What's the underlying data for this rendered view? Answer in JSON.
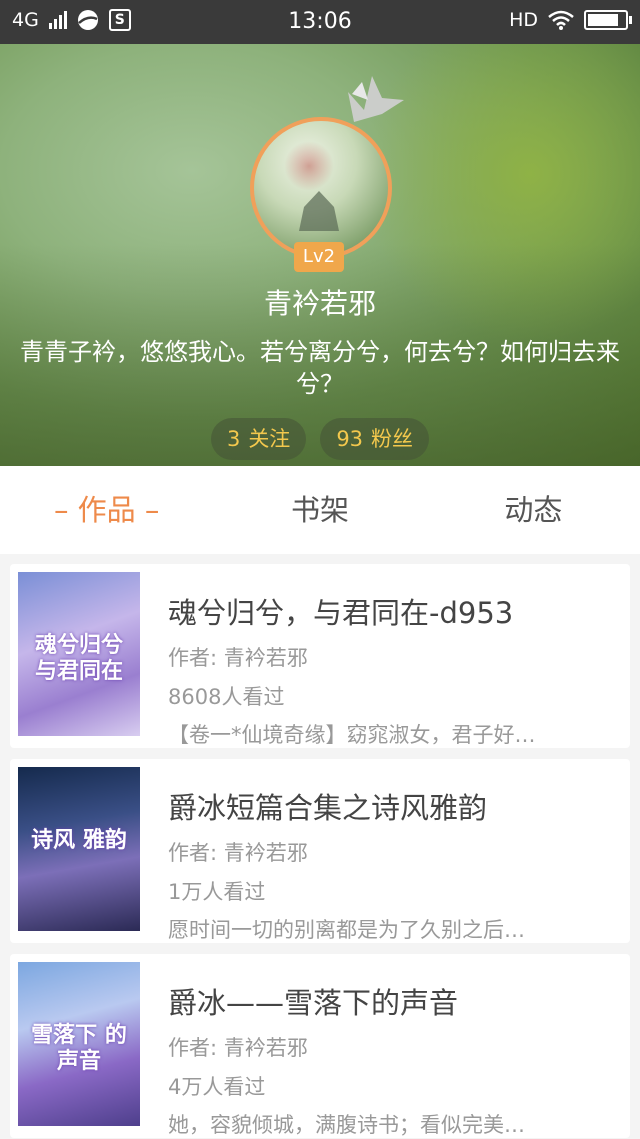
{
  "status_bar": {
    "network": "4G",
    "time": "13:06",
    "hd": "HD",
    "app_icon_letter": "S",
    "battery_level": 0.95
  },
  "profile": {
    "level": "Lv2",
    "username": "青衿若邪",
    "bio": "青青子衿，悠悠我心。若兮离分兮，何去兮？如何归去来兮？",
    "following_count": "3",
    "following_label": "关注",
    "fans_count": "93",
    "fans_label": "粉丝"
  },
  "tabs": [
    {
      "label": "作品",
      "active": true
    },
    {
      "label": "书架",
      "active": false
    },
    {
      "label": "动态",
      "active": false
    }
  ],
  "books": [
    {
      "title": "魂兮归兮，与君同在-d953",
      "author": "作者: 青衿若邪",
      "views": "8608人看过",
      "desc": "【卷一*仙境奇缘】窈窕淑女，君子好…",
      "cover_text": "魂兮归兮 与君同在"
    },
    {
      "title": "爵冰短篇合集之诗风雅韵",
      "author": "作者: 青衿若邪",
      "views": "1万人看过",
      "desc": "愿时间一切的别离都是为了久别之后…",
      "cover_text": "诗风 雅韵"
    },
    {
      "title": "爵冰——雪落下的声音",
      "author": "作者: 青衿若邪",
      "views": "4万人看过",
      "desc": "她，容貌倾城，满腹诗书；看似完美…",
      "cover_text": "雪落下 的声音"
    }
  ],
  "colors": {
    "accent": "#ee8a4a",
    "badge": "#f0a74b",
    "stat_text": "#f3c84d"
  }
}
